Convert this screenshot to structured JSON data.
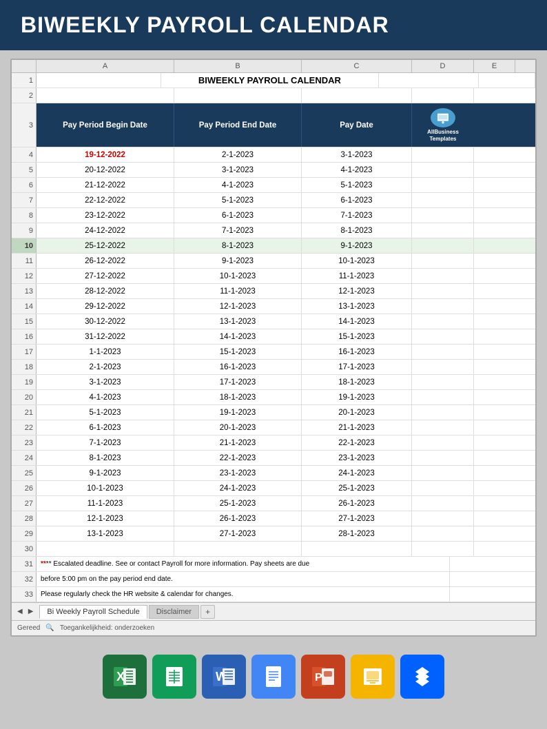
{
  "header": {
    "title": "BIWEEKLY PAYROLL CALENDAR"
  },
  "spreadsheet": {
    "col_letters": [
      "A",
      "B",
      "C",
      "D",
      "E"
    ],
    "title_row1": "BIWEEKLY PAYROLL CALENDAR",
    "table_headers": [
      "Pay Period Begin Date",
      "Pay Period End Date",
      "Pay Date"
    ],
    "logo_text": "AllBusiness Templates",
    "rows": [
      {
        "num": 4,
        "a": "19-12-2022",
        "b": "2-1-2023",
        "c": "3-1-2023",
        "red": true
      },
      {
        "num": 5,
        "a": "20-12-2022",
        "b": "3-1-2023",
        "c": "4-1-2023"
      },
      {
        "num": 6,
        "a": "21-12-2022",
        "b": "4-1-2023",
        "c": "5-1-2023"
      },
      {
        "num": 7,
        "a": "22-12-2022",
        "b": "5-1-2023",
        "c": "6-1-2023"
      },
      {
        "num": 8,
        "a": "23-12-2022",
        "b": "6-1-2023",
        "c": "7-1-2023"
      },
      {
        "num": 9,
        "a": "24-12-2022",
        "b": "7-1-2023",
        "c": "8-1-2023"
      },
      {
        "num": 10,
        "a": "25-12-2022",
        "b": "8-1-2023",
        "c": "9-1-2023",
        "selected": true
      },
      {
        "num": 11,
        "a": "26-12-2022",
        "b": "9-1-2023",
        "c": "10-1-2023"
      },
      {
        "num": 12,
        "a": "27-12-2022",
        "b": "10-1-2023",
        "c": "11-1-2023"
      },
      {
        "num": 13,
        "a": "28-12-2022",
        "b": "11-1-2023",
        "c": "12-1-2023"
      },
      {
        "num": 14,
        "a": "29-12-2022",
        "b": "12-1-2023",
        "c": "13-1-2023"
      },
      {
        "num": 15,
        "a": "30-12-2022",
        "b": "13-1-2023",
        "c": "14-1-2023"
      },
      {
        "num": 16,
        "a": "31-12-2022",
        "b": "14-1-2023",
        "c": "15-1-2023"
      },
      {
        "num": 17,
        "a": "1-1-2023",
        "b": "15-1-2023",
        "c": "16-1-2023"
      },
      {
        "num": 18,
        "a": "2-1-2023",
        "b": "16-1-2023",
        "c": "17-1-2023"
      },
      {
        "num": 19,
        "a": "3-1-2023",
        "b": "17-1-2023",
        "c": "18-1-2023"
      },
      {
        "num": 20,
        "a": "4-1-2023",
        "b": "18-1-2023",
        "c": "19-1-2023"
      },
      {
        "num": 21,
        "a": "5-1-2023",
        "b": "19-1-2023",
        "c": "20-1-2023"
      },
      {
        "num": 22,
        "a": "6-1-2023",
        "b": "20-1-2023",
        "c": "21-1-2023"
      },
      {
        "num": 23,
        "a": "7-1-2023",
        "b": "21-1-2023",
        "c": "22-1-2023"
      },
      {
        "num": 24,
        "a": "8-1-2023",
        "b": "22-1-2023",
        "c": "23-1-2023"
      },
      {
        "num": 25,
        "a": "9-1-2023",
        "b": "23-1-2023",
        "c": "24-1-2023"
      },
      {
        "num": 26,
        "a": "10-1-2023",
        "b": "24-1-2023",
        "c": "25-1-2023"
      },
      {
        "num": 27,
        "a": "11-1-2023",
        "b": "25-1-2023",
        "c": "26-1-2023"
      },
      {
        "num": 28,
        "a": "12-1-2023",
        "b": "26-1-2023",
        "c": "27-1-2023"
      },
      {
        "num": 29,
        "a": "13-1-2023",
        "b": "27-1-2023",
        "c": "28-1-2023"
      }
    ],
    "note_row31": "** Escalated deadline. See  or contact Payroll for more information. Pay sheets are due",
    "note_row32": "before 5:00 pm on the pay period end date.",
    "note_row33": "Please regularly check the HR website & calendar for changes."
  },
  "tabs": {
    "active": "Bi Weekly Payroll Schedule",
    "inactive": "Disclaimer",
    "add_label": "+"
  },
  "status_bar": {
    "ready": "Gereed",
    "accessibility": "Toegankelijkheid: onderzoeken"
  },
  "app_icons": [
    {
      "name": "Excel",
      "type": "excel"
    },
    {
      "name": "Sheets",
      "type": "sheets"
    },
    {
      "name": "Word",
      "type": "word"
    },
    {
      "name": "Docs",
      "type": "docs"
    },
    {
      "name": "PowerPoint",
      "type": "ppt"
    },
    {
      "name": "Slides",
      "type": "slides"
    },
    {
      "name": "Dropbox",
      "type": "dropbox"
    }
  ]
}
